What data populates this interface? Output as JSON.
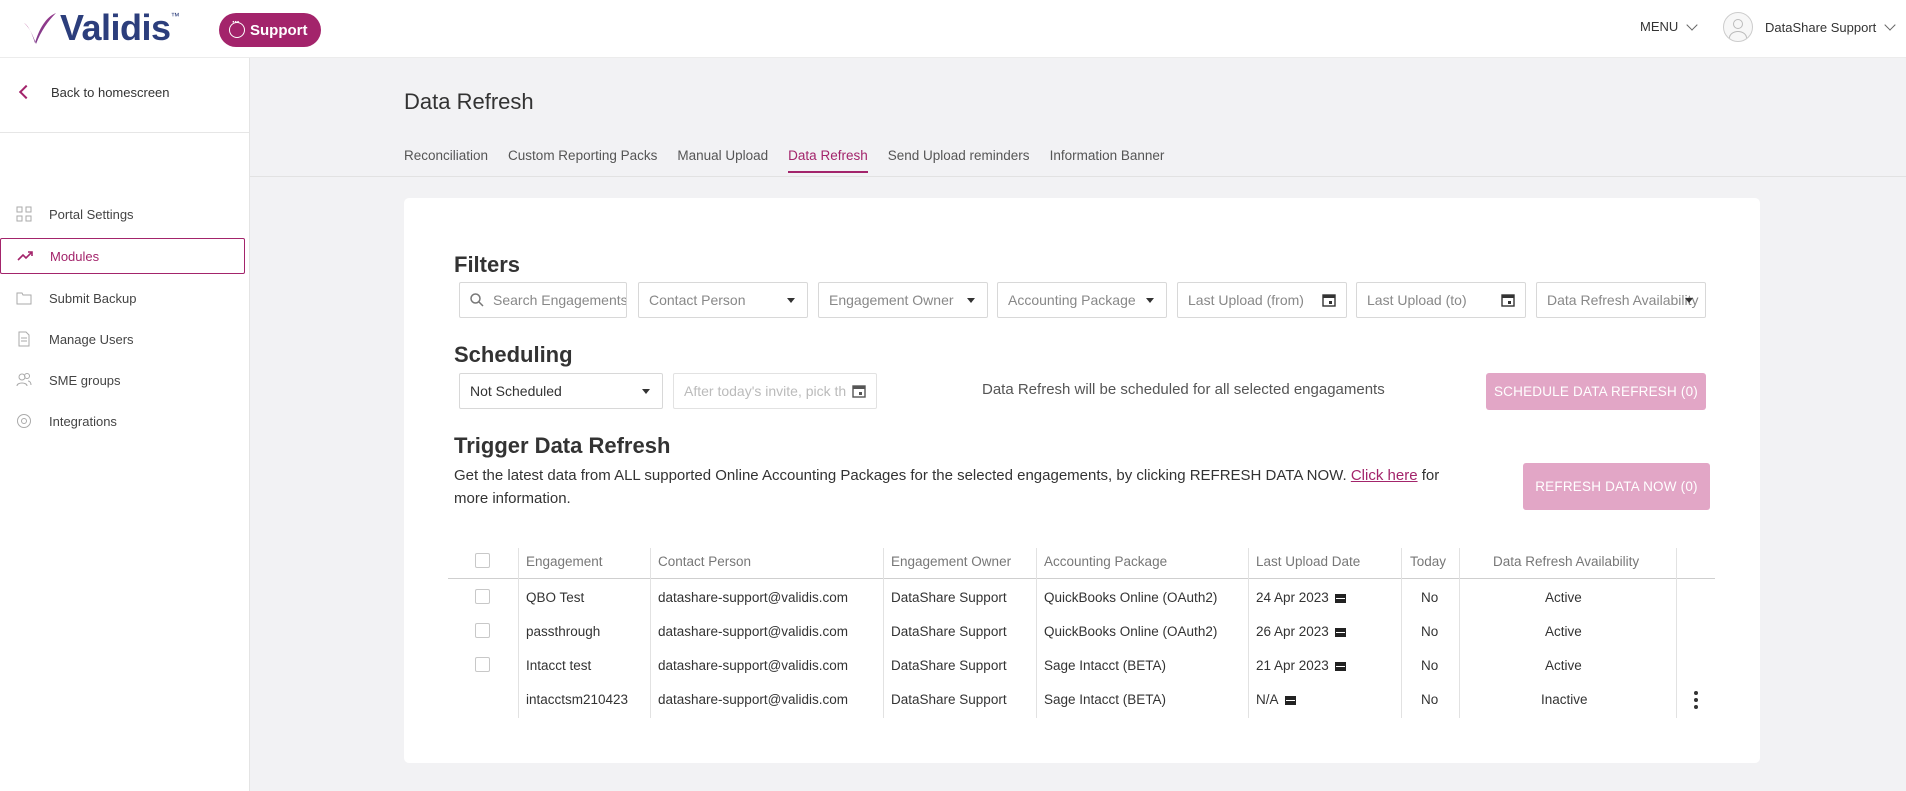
{
  "header": {
    "logo": "Validis",
    "support_label": "Support",
    "menu_label": "MENU",
    "user_name": "DataShare Support"
  },
  "sidebar": {
    "back_label": "Back to homescreen",
    "items": [
      {
        "label": "Portal Settings",
        "icon": "grid-icon"
      },
      {
        "label": "Modules",
        "icon": "trend-icon",
        "active": true
      },
      {
        "label": "Submit Backup",
        "icon": "folder-icon"
      },
      {
        "label": "Manage Users",
        "icon": "document-icon"
      },
      {
        "label": "SME groups",
        "icon": "users-icon"
      },
      {
        "label": "Integrations",
        "icon": "target-icon"
      }
    ]
  },
  "page": {
    "title": "Data Refresh",
    "tabs": [
      "Reconciliation",
      "Custom Reporting Packs",
      "Manual Upload",
      "Data Refresh",
      "Send Upload reminders",
      "Information Banner"
    ],
    "active_tab": "Data Refresh"
  },
  "filters": {
    "title": "Filters",
    "search_placeholder": "Search Engagements",
    "contact_person": "Contact Person",
    "engagement_owner": "Engagement Owner",
    "accounting_package": "Accounting Package",
    "last_upload_from": "Last Upload (from)",
    "last_upload_to": "Last Upload (to)",
    "data_refresh_availability": "Data Refresh Availability"
  },
  "scheduling": {
    "title": "Scheduling",
    "select_value": "Not Scheduled",
    "date_placeholder": "After today's invite, pick the date",
    "info_text": "Data Refresh will be scheduled for all selected engagaments",
    "button_label": "SCHEDULE DATA REFRESH (0)"
  },
  "trigger": {
    "title": "Trigger Data Refresh",
    "desc_before": "Get the latest data from ALL supported Online Accounting Packages for the selected engagements, by clicking REFRESH DATA NOW. ",
    "link_text": "Click here",
    "desc_after": " for more information.",
    "button_label": "REFRESH DATA NOW (0)"
  },
  "table": {
    "columns": [
      "Engagement",
      "Contact Person",
      "Engagement Owner",
      "Accounting Package",
      "Last Upload Date",
      "Today",
      "Data Refresh Availability"
    ],
    "rows": [
      {
        "engagement": "QBO Test",
        "contact": "datashare-support@validis.com",
        "owner": "DataShare Support",
        "package": "QuickBooks Online (OAuth2)",
        "last_upload": "24 Apr 2023",
        "today": "No",
        "availability": "Active",
        "checkbox": true
      },
      {
        "engagement": "passthrough",
        "contact": "datashare-support@validis.com",
        "owner": "DataShare Support",
        "package": "QuickBooks Online (OAuth2)",
        "last_upload": "26 Apr 2023",
        "today": "No",
        "availability": "Active",
        "checkbox": true
      },
      {
        "engagement": "Intacct test",
        "contact": "datashare-support@validis.com",
        "owner": "DataShare Support",
        "package": "Sage Intacct (BETA)",
        "last_upload": "21 Apr 2023",
        "today": "No",
        "availability": "Active",
        "checkbox": true
      },
      {
        "engagement": "intacctsm210423",
        "contact": "datashare-support@validis.com",
        "owner": "DataShare Support",
        "package": "Sage Intacct (BETA)",
        "last_upload": "N/A",
        "today": "No",
        "availability": "Inactive",
        "checkbox": false
      }
    ]
  },
  "colors": {
    "accent": "#a3246b",
    "button_disabled": "#e2a6c6",
    "logo": "#2c3e7c"
  }
}
